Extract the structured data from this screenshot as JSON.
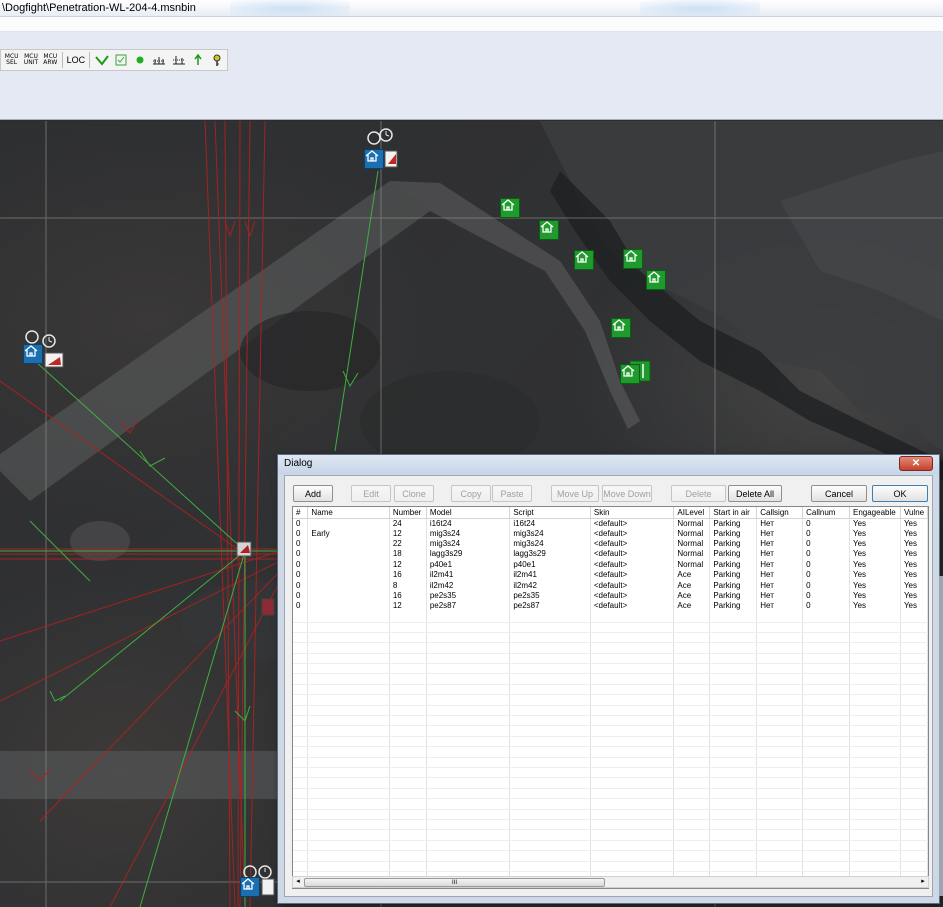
{
  "window": {
    "title": "\\Dogfight\\Penetration-WL-204-4.msnbin"
  },
  "toolbar": {
    "buttons": [
      {
        "name": "mcu-sel",
        "label_top": "MCU",
        "label_bottom": "SEL"
      },
      {
        "name": "mcu-unit",
        "label_top": "MCU",
        "label_bottom": "UNIT"
      },
      {
        "name": "mcu-arw",
        "label_top": "MCU",
        "label_bottom": "ARW"
      }
    ],
    "loc_label": "LOC"
  },
  "dialog": {
    "title": "Dialog",
    "close_label": "✕",
    "buttons": {
      "add": "Add",
      "edit": "Edit",
      "clone": "Clone",
      "copy": "Copy",
      "paste": "Paste",
      "move_up": "Move Up",
      "move_down": "Move Down",
      "delete": "Delete",
      "delete_all": "Delete All",
      "cancel": "Cancel",
      "ok": "OK"
    },
    "columns": [
      "#",
      "Name",
      "Number",
      "Model",
      "Script",
      "Skin",
      "AILevel",
      "Start in air",
      "Callsign",
      "Callnum",
      "Engageable",
      "Vulne"
    ],
    "rows": [
      [
        "0",
        "",
        "24",
        "i16t24",
        "i16t24",
        "<default>",
        "Normal",
        "Parking",
        "Нет",
        "0",
        "Yes",
        "Yes"
      ],
      [
        "0",
        "Early",
        "12",
        "mig3s24",
        "mig3s24",
        "<default>",
        "Normal",
        "Parking",
        "Нет",
        "0",
        "Yes",
        "Yes"
      ],
      [
        "0",
        "",
        "22",
        "mig3s24",
        "mig3s24",
        "<default>",
        "Normal",
        "Parking",
        "Нет",
        "0",
        "Yes",
        "Yes"
      ],
      [
        "0",
        "",
        "18",
        "lagg3s29",
        "lagg3s29",
        "<default>",
        "Normal",
        "Parking",
        "Нет",
        "0",
        "Yes",
        "Yes"
      ],
      [
        "0",
        "",
        "12",
        "p40e1",
        "p40e1",
        "<default>",
        "Normal",
        "Parking",
        "Нет",
        "0",
        "Yes",
        "Yes"
      ],
      [
        "0",
        "",
        "16",
        "il2m41",
        "il2m41",
        "<default>",
        "Ace",
        "Parking",
        "Нет",
        "0",
        "Yes",
        "Yes"
      ],
      [
        "0",
        "",
        "8",
        "il2m42",
        "il2m42",
        "<default>",
        "Ace",
        "Parking",
        "Нет",
        "0",
        "Yes",
        "Yes"
      ],
      [
        "0",
        "",
        "16",
        "pe2s35",
        "pe2s35",
        "<default>",
        "Ace",
        "Parking",
        "Нет",
        "0",
        "Yes",
        "Yes"
      ],
      [
        "0",
        "",
        "12",
        "pe2s87",
        "pe2s87",
        "<default>",
        "Ace",
        "Parking",
        "Нет",
        "0",
        "Yes",
        "Yes"
      ]
    ],
    "scroll_grip": "III",
    "scroll_left": "◂",
    "scroll_right": "▸"
  },
  "colors": {
    "house_marker": "#1f9a2c",
    "route_green": "#3fae3f",
    "route_red": "#b02020",
    "grid_line": "#8a8a8a"
  },
  "icons": [
    "check-icon",
    "waypoint-icon",
    "dot-icon",
    "ruler-icon",
    "arrow-up-icon",
    "key-icon",
    "house-icon",
    "timer-icon"
  ]
}
